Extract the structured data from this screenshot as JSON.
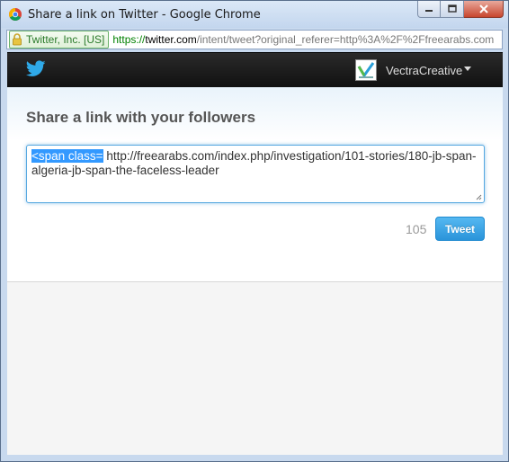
{
  "window": {
    "title": "Share a link on Twitter - Google Chrome"
  },
  "address_bar": {
    "ev_label": "Twitter, Inc. [US]",
    "url_scheme": "https://",
    "url_domain": "twitter.com",
    "url_path": "/intent/tweet?original_referer=http%3A%2F%2Ffreearabs.com"
  },
  "header": {
    "logo_icon": "twitter-bird-icon",
    "account_name": "VectraCreative"
  },
  "share": {
    "heading": "Share a link with your followers",
    "tweet_selected_text": "<span class=",
    "tweet_text_rest": " http://freearabs.com/index.php/investigation/101-stories/180-jb-span-algeria-jb-span-the-faceless-leader",
    "char_count": "105",
    "tweet_button_label": "Tweet"
  },
  "colors": {
    "twitter_blue": "#2a94da",
    "selection": "#3399ff",
    "topbar": "#1a1a1a"
  }
}
